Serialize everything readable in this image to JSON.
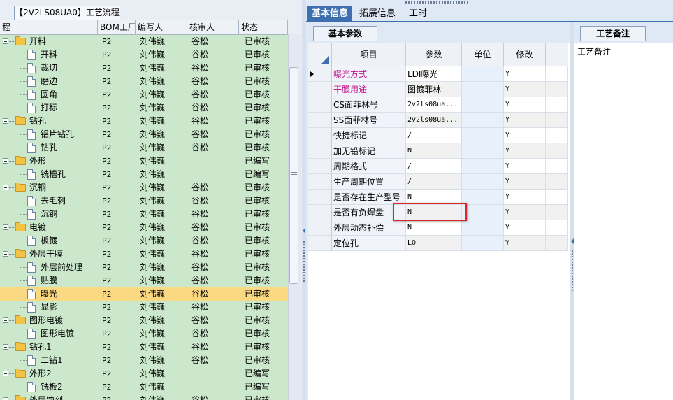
{
  "left_panel": {
    "tab_title": "【2V2LS08UA0】工艺流程",
    "columns": [
      "程",
      "BOM工厂",
      "编写人",
      "核审人",
      "状态"
    ],
    "rows": [
      {
        "level": 0,
        "type": "folder",
        "name": "开料",
        "bom": "P2",
        "writer": "刘伟巍",
        "reviewer": "谷松",
        "status": "已审核"
      },
      {
        "level": 1,
        "type": "doc",
        "name": "开料",
        "bom": "P2",
        "writer": "刘伟巍",
        "reviewer": "谷松",
        "status": "已审核"
      },
      {
        "level": 1,
        "type": "doc",
        "name": "裁切",
        "bom": "P2",
        "writer": "刘伟巍",
        "reviewer": "谷松",
        "status": "已审核"
      },
      {
        "level": 1,
        "type": "doc",
        "name": "磨边",
        "bom": "P2",
        "writer": "刘伟巍",
        "reviewer": "谷松",
        "status": "已审核"
      },
      {
        "level": 1,
        "type": "doc",
        "name": "圆角",
        "bom": "P2",
        "writer": "刘伟巍",
        "reviewer": "谷松",
        "status": "已审核"
      },
      {
        "level": 1,
        "type": "doc",
        "name": "打标",
        "bom": "P2",
        "writer": "刘伟巍",
        "reviewer": "谷松",
        "status": "已审核"
      },
      {
        "level": 0,
        "type": "folder",
        "name": "钻孔",
        "bom": "P2",
        "writer": "刘伟巍",
        "reviewer": "谷松",
        "status": "已审核"
      },
      {
        "level": 1,
        "type": "doc",
        "name": "铝片钻孔",
        "bom": "P2",
        "writer": "刘伟巍",
        "reviewer": "谷松",
        "status": "已审核"
      },
      {
        "level": 1,
        "type": "doc",
        "name": "钻孔",
        "bom": "P2",
        "writer": "刘伟巍",
        "reviewer": "谷松",
        "status": "已审核"
      },
      {
        "level": 0,
        "type": "folder",
        "name": "外形",
        "bom": "P2",
        "writer": "刘伟巍",
        "reviewer": "",
        "status": "已编写"
      },
      {
        "level": 1,
        "type": "doc",
        "name": "铣槽孔",
        "bom": "P2",
        "writer": "刘伟巍",
        "reviewer": "",
        "status": "已编写"
      },
      {
        "level": 0,
        "type": "folder",
        "name": "沉铜",
        "bom": "P2",
        "writer": "刘伟巍",
        "reviewer": "谷松",
        "status": "已审核"
      },
      {
        "level": 1,
        "type": "doc",
        "name": "去毛刺",
        "bom": "P2",
        "writer": "刘伟巍",
        "reviewer": "谷松",
        "status": "已审核"
      },
      {
        "level": 1,
        "type": "doc",
        "name": "沉铜",
        "bom": "P2",
        "writer": "刘伟巍",
        "reviewer": "谷松",
        "status": "已审核"
      },
      {
        "level": 0,
        "type": "folder",
        "name": "电镀",
        "bom": "P2",
        "writer": "刘伟巍",
        "reviewer": "谷松",
        "status": "已审核"
      },
      {
        "level": 1,
        "type": "doc",
        "name": "板镀",
        "bom": "P2",
        "writer": "刘伟巍",
        "reviewer": "谷松",
        "status": "已审核"
      },
      {
        "level": 0,
        "type": "folder",
        "name": "外层干膜",
        "bom": "P2",
        "writer": "刘伟巍",
        "reviewer": "谷松",
        "status": "已审核"
      },
      {
        "level": 1,
        "type": "doc",
        "name": "外层前处理",
        "bom": "P2",
        "writer": "刘伟巍",
        "reviewer": "谷松",
        "status": "已审核"
      },
      {
        "level": 1,
        "type": "doc",
        "name": "贴膜",
        "bom": "P2",
        "writer": "刘伟巍",
        "reviewer": "谷松",
        "status": "已审核"
      },
      {
        "level": 1,
        "type": "doc",
        "name": "曝光",
        "bom": "P2",
        "writer": "刘伟巍",
        "reviewer": "谷松",
        "status": "已审核",
        "selected": true
      },
      {
        "level": 1,
        "type": "doc",
        "name": "显影",
        "bom": "P2",
        "writer": "刘伟巍",
        "reviewer": "谷松",
        "status": "已审核"
      },
      {
        "level": 0,
        "type": "folder",
        "name": "图形电镀",
        "bom": "P2",
        "writer": "刘伟巍",
        "reviewer": "谷松",
        "status": "已审核"
      },
      {
        "level": 1,
        "type": "doc",
        "name": "图形电镀",
        "bom": "P2",
        "writer": "刘伟巍",
        "reviewer": "谷松",
        "status": "已审核"
      },
      {
        "level": 0,
        "type": "folder",
        "name": "钻孔1",
        "bom": "P2",
        "writer": "刘伟巍",
        "reviewer": "谷松",
        "status": "已审核"
      },
      {
        "level": 1,
        "type": "doc",
        "name": "二钻1",
        "bom": "P2",
        "writer": "刘伟巍",
        "reviewer": "谷松",
        "status": "已审核"
      },
      {
        "level": 0,
        "type": "folder",
        "name": "外形2",
        "bom": "P2",
        "writer": "刘伟巍",
        "reviewer": "",
        "status": "已编写"
      },
      {
        "level": 1,
        "type": "doc",
        "name": "铣板2",
        "bom": "P2",
        "writer": "刘伟巍",
        "reviewer": "",
        "status": "已编写"
      },
      {
        "level": 0,
        "type": "folder",
        "name": "外层蚀刻",
        "bom": "P2",
        "writer": "刘伟巍",
        "reviewer": "谷松",
        "status": "已审核"
      }
    ]
  },
  "top_tabs": [
    "基本信息",
    "拓展信息",
    "工时"
  ],
  "middle_panel": {
    "sub_tab": "基本参数",
    "columns": [
      "项目",
      "参数",
      "单位",
      "修改"
    ],
    "rows": [
      {
        "item": "曝光方式",
        "param": "LDI曝光",
        "unit": "",
        "modify": "Y",
        "pink": true,
        "current": true
      },
      {
        "item": "干膜用途",
        "param": "图镀菲林",
        "unit": "",
        "modify": "Y",
        "pink": true
      },
      {
        "item": "CS面菲林号",
        "param": "2v2ls08ua...",
        "unit": "",
        "modify": "Y"
      },
      {
        "item": "SS面菲林号",
        "param": "2v2ls08ua...",
        "unit": "",
        "modify": "Y"
      },
      {
        "item": "快捷标记",
        "param": "/",
        "unit": "",
        "modify": "Y"
      },
      {
        "item": "加无铅标记",
        "param": "N",
        "unit": "",
        "modify": "Y"
      },
      {
        "item": "周期格式",
        "param": "/",
        "unit": "",
        "modify": "Y"
      },
      {
        "item": "生产周期位置",
        "param": "/",
        "unit": "",
        "modify": "Y"
      },
      {
        "item": "是否存在生产型号",
        "param": "N",
        "unit": "",
        "modify": "Y"
      },
      {
        "item": "是否有负焊盘",
        "param": "N",
        "unit": "",
        "modify": "Y"
      },
      {
        "item": "外层动态补偿",
        "param": "N",
        "unit": "",
        "modify": "Y"
      },
      {
        "item": "定位孔",
        "param": "LO",
        "unit": "",
        "modify": "Y"
      }
    ]
  },
  "right_panel": {
    "tab_title": "工艺备注",
    "label": "工艺备注"
  },
  "colors": {
    "tree_bg": "#cce8cc",
    "selected_row": "#fbd982",
    "tab_active": "#3d6fb0",
    "pink_text": "#c0188a",
    "highlight_box": "#d9272a"
  }
}
